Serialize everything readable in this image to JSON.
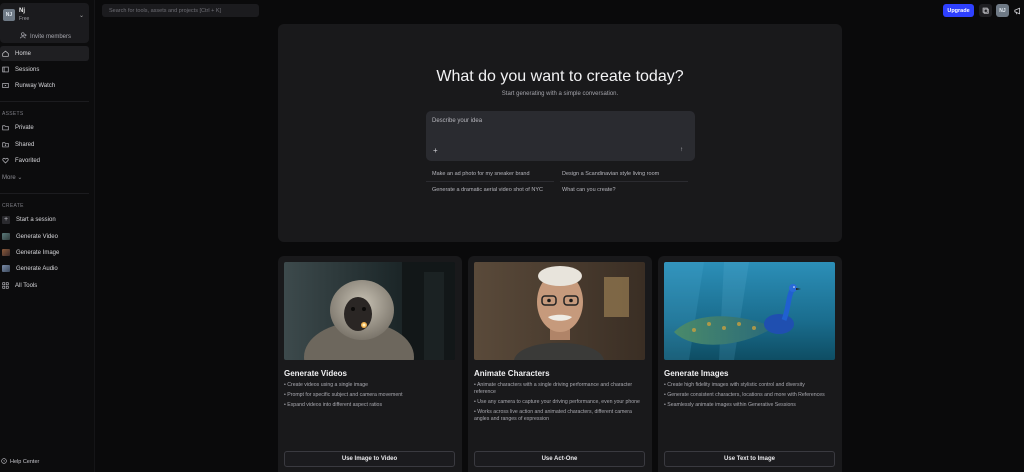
{
  "workspace": {
    "initials": "NJ",
    "name": "Nj",
    "plan": "Free",
    "invite_label": "Invite members"
  },
  "nav": {
    "home": "Home",
    "sessions": "Sessions",
    "runway_watch": "Runway Watch"
  },
  "assets": {
    "label": "ASSETS",
    "private": "Private",
    "shared": "Shared",
    "favorited": "Favorited",
    "more": "More"
  },
  "create": {
    "label": "CREATE",
    "start_session": "Start a session",
    "generate_video": "Generate Video",
    "generate_image": "Generate Image",
    "generate_audio": "Generate Audio",
    "all_tools": "All Tools"
  },
  "help_center": "Help Center",
  "search": {
    "placeholder": "Search for tools, assets and projects [Ctrl + K]"
  },
  "topbar": {
    "upgrade": "Upgrade",
    "avatar_initials": "NJ"
  },
  "hero": {
    "title": "What do you want to create today?",
    "subtitle": "Start generating with a simple conversation.",
    "prompt_placeholder": "Describe your idea",
    "suggestions": [
      "Make an ad photo for my sneaker brand",
      "Design a Scandinavian style living room",
      "Generate a dramatic aerial video shot of NYC",
      "What can you create?"
    ]
  },
  "cards": [
    {
      "title": "Generate Videos",
      "bullets": [
        "• Create videos using a single image",
        "• Prompt for specific subject and camera movement",
        "• Expand videos into different aspect ratios"
      ],
      "button": "Use Image to Video"
    },
    {
      "title": "Animate Characters",
      "bullets": [
        "• Animate characters with a single driving performance and character reference",
        "• Use any camera to capture your driving performance, even your phone",
        "• Works across live action and animated characters, different camera angles and ranges of expression"
      ],
      "button": "Use Act-One"
    },
    {
      "title": "Generate Images",
      "bullets": [
        "• Create high fidelity images with stylistic control and diversity",
        "• Generate consistent characters, locations and more with References",
        "• Seamlessly animate images within Generative Sessions"
      ],
      "button": "Use Text to Image"
    }
  ],
  "colors": {
    "accent": "#2e40ff",
    "background": "#0a0a0b",
    "panel": "#19191b"
  }
}
